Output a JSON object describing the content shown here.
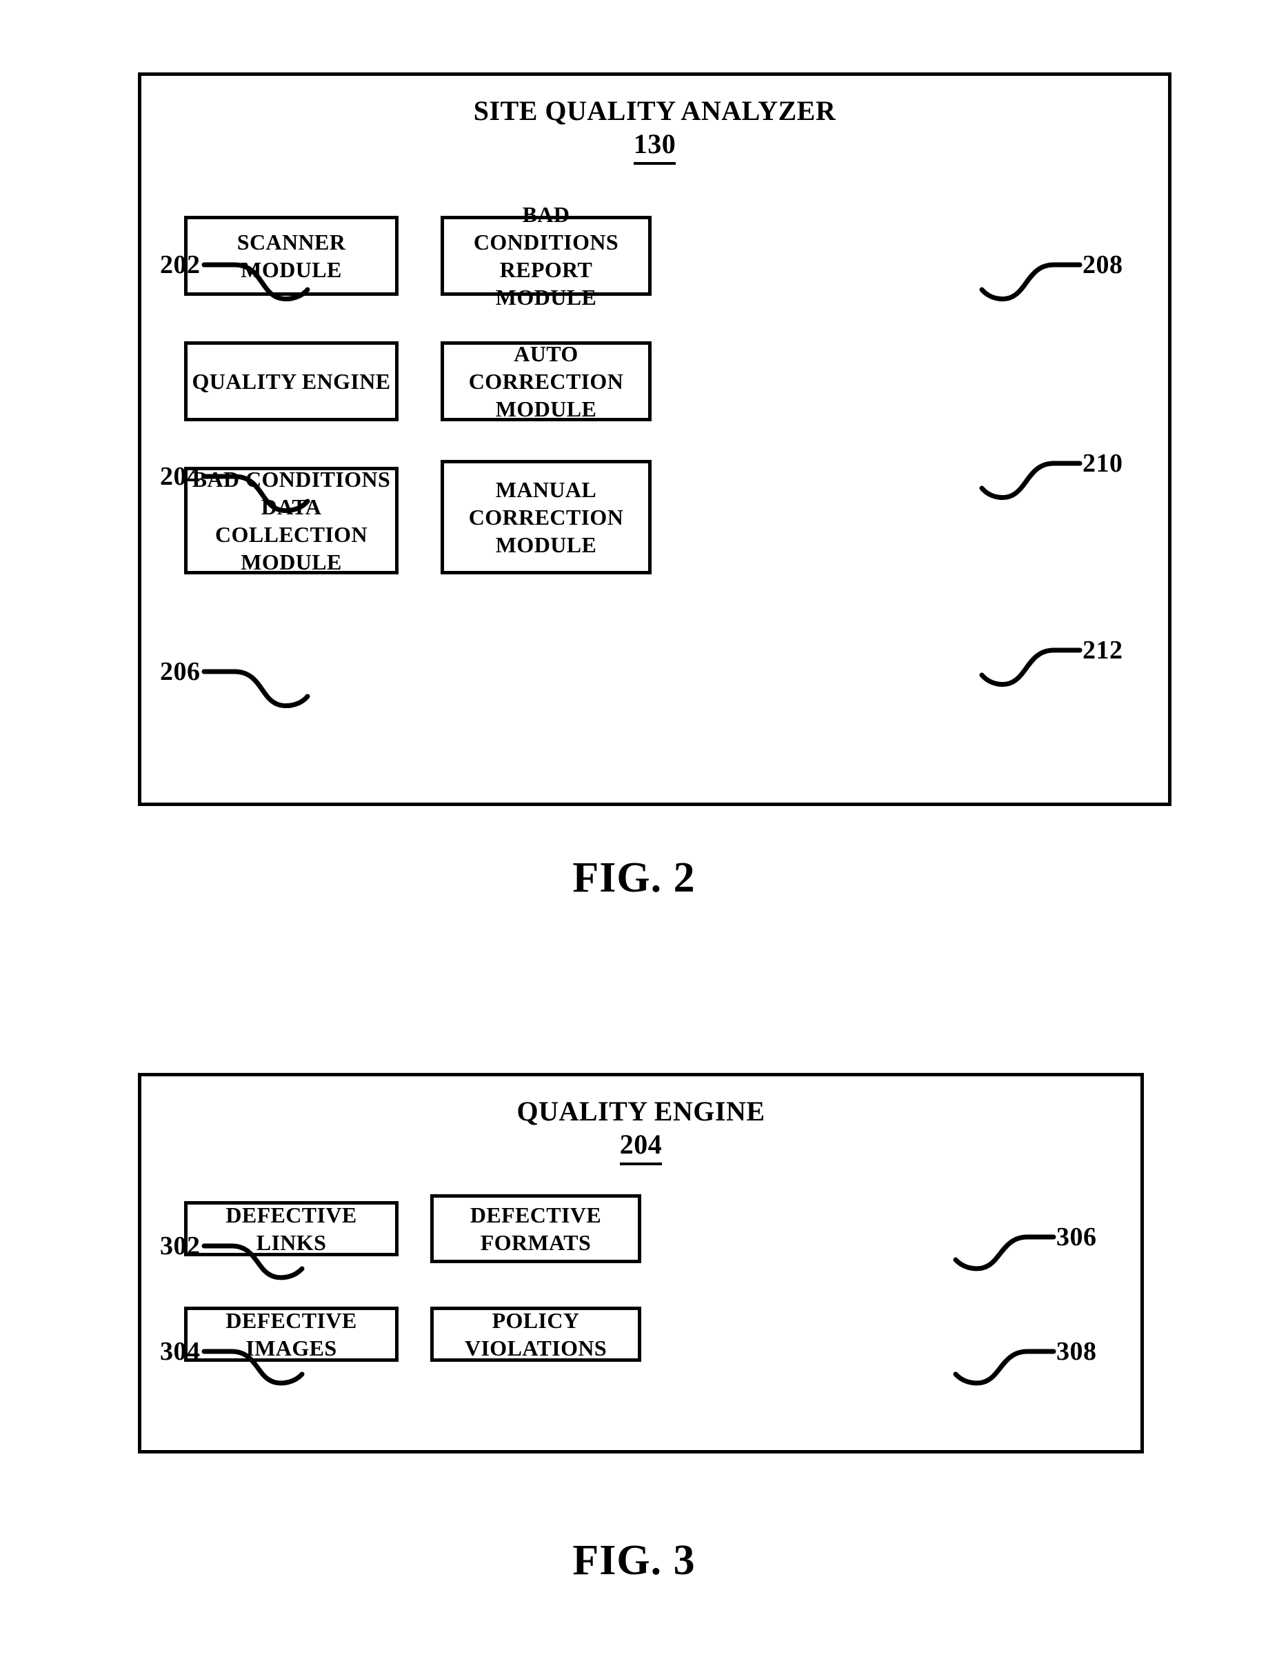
{
  "document": {
    "type": "patent-figure-sheet"
  },
  "figures": [
    {
      "id": "fig2",
      "caption": "FIG. 2",
      "title": "SITE QUALITY ANALYZER",
      "title_number": "130",
      "boxes": [
        {
          "ref": "202",
          "label": "SCANNER MODULE",
          "ref_side": "left"
        },
        {
          "ref": "208",
          "label": "BAD CONDITIONS\nREPORT MODULE",
          "ref_side": "right"
        },
        {
          "ref": "204",
          "label": "QUALITY ENGINE",
          "ref_side": "left"
        },
        {
          "ref": "210",
          "label": "AUTO CORRECTION\nMODULE",
          "ref_side": "right"
        },
        {
          "ref": "206",
          "label": "BAD CONDITIONS\nDATA COLLECTION\nMODULE",
          "ref_side": "left"
        },
        {
          "ref": "212",
          "label": "MANUAL\nCORRECTION\nMODULE",
          "ref_side": "right"
        }
      ]
    },
    {
      "id": "fig3",
      "caption": "FIG. 3",
      "title": "QUALITY ENGINE",
      "title_number": "204",
      "boxes": [
        {
          "ref": "302",
          "label": "DEFECTIVE LINKS",
          "ref_side": "left"
        },
        {
          "ref": "306",
          "label": "DEFECTIVE\nFORMATS",
          "ref_side": "right"
        },
        {
          "ref": "304",
          "label": "DEFECTIVE IMAGES",
          "ref_side": "left"
        },
        {
          "ref": "308",
          "label": "POLICY VIOLATIONS",
          "ref_side": "right"
        }
      ]
    }
  ],
  "colors": {
    "ink": "#000000",
    "paper": "#ffffff"
  }
}
